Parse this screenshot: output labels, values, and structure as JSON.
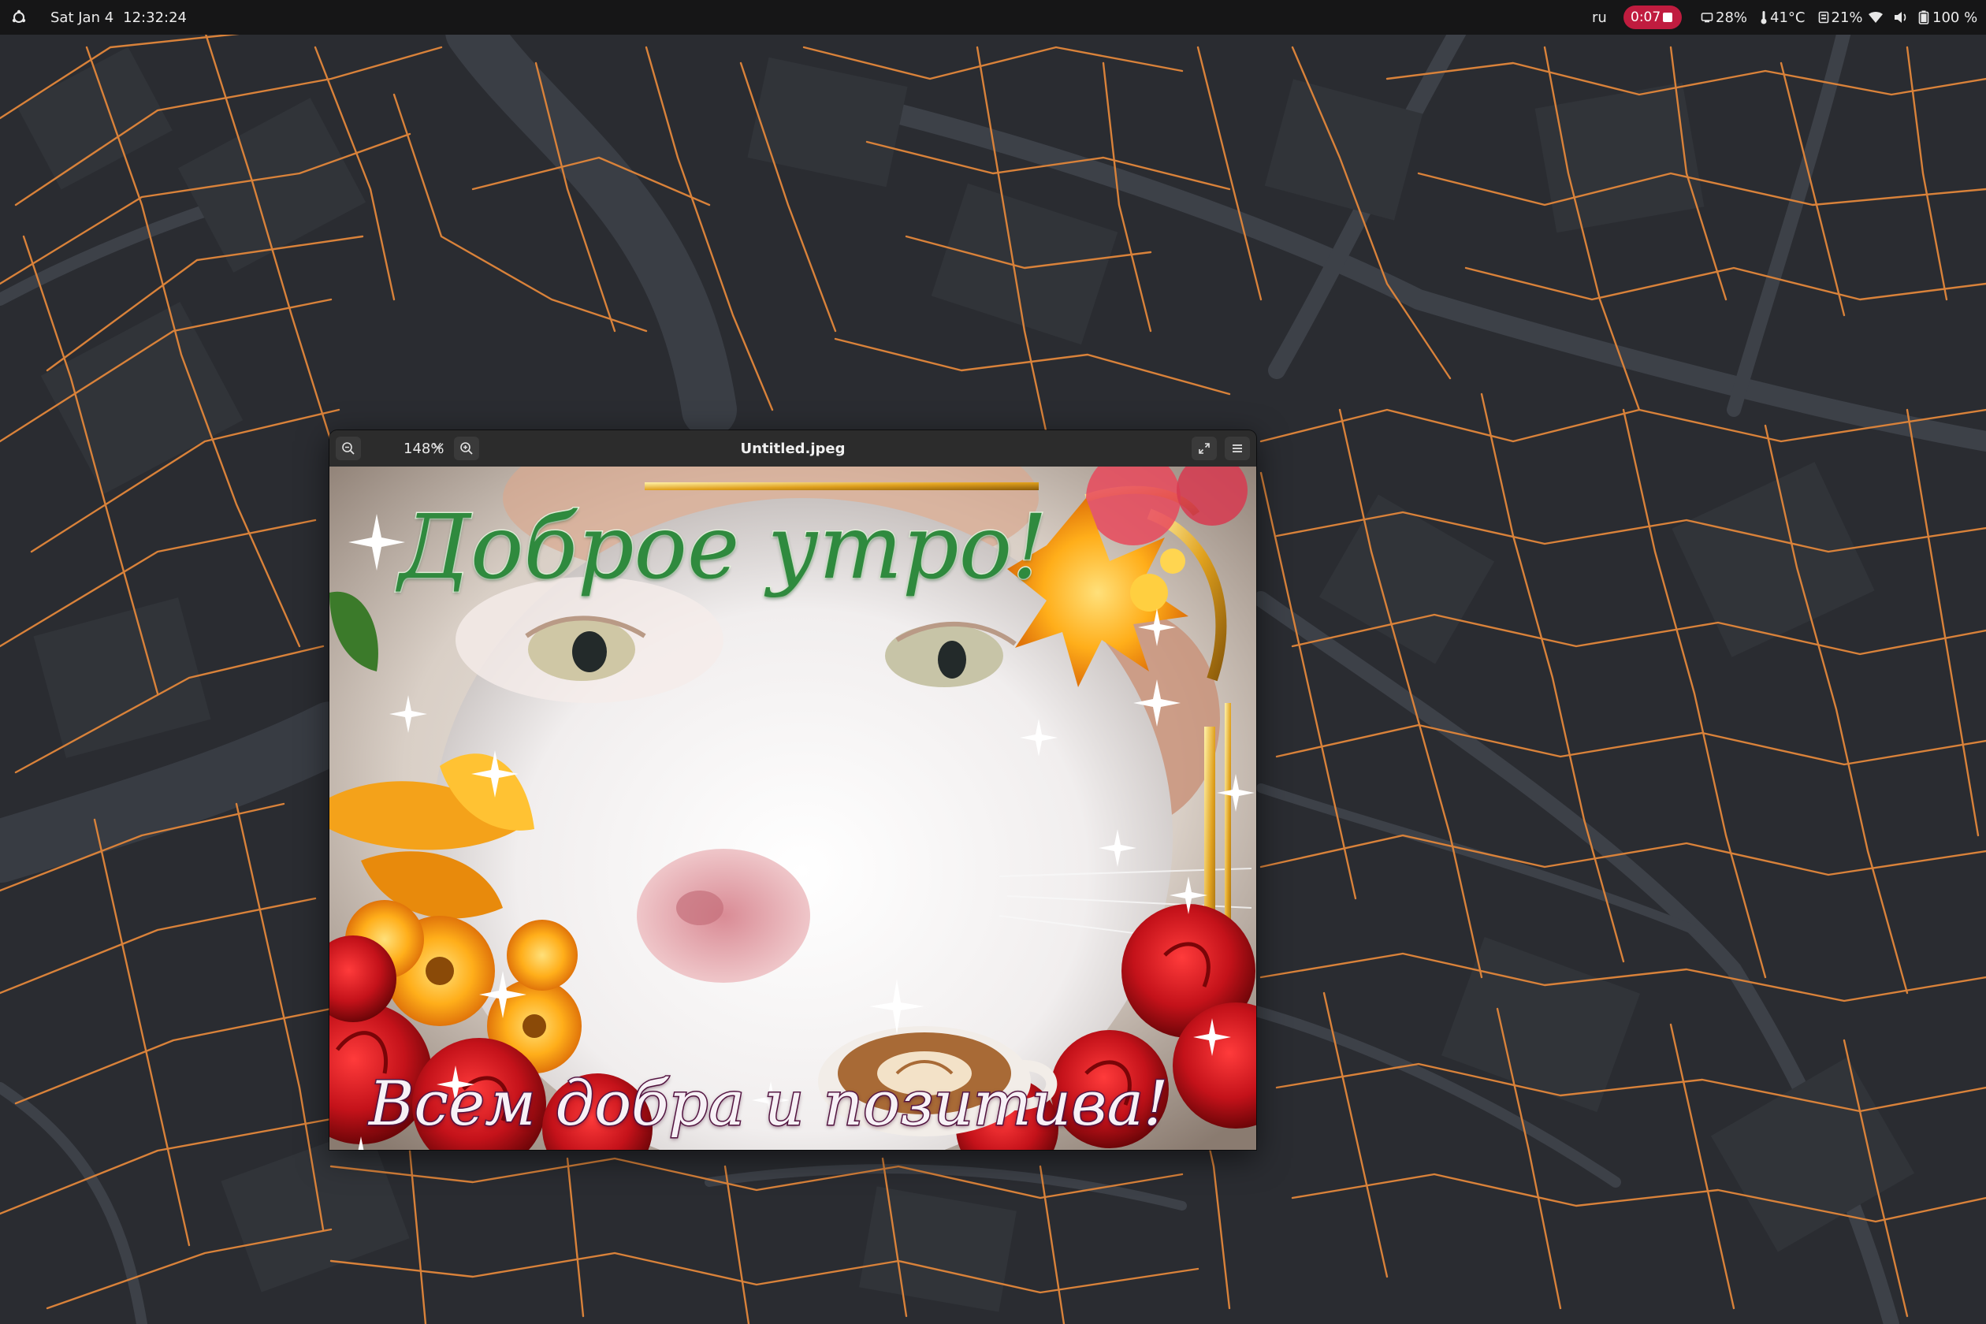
{
  "top_panel": {
    "date": "Sat Jan 4",
    "time": "12:32:24",
    "keyboard_layout": "ru",
    "recording_time": "0:07",
    "cpu": "28%",
    "temperature": "41°C",
    "memory": "21%",
    "battery": "100 %",
    "icons": [
      "activities-icon",
      "stop-recording-icon",
      "cpu-icon",
      "thermometer-icon",
      "memory-icon",
      "wifi-icon",
      "volume-icon",
      "battery-icon"
    ]
  },
  "viewer": {
    "title": "Untitled.jpeg",
    "zoom_level": "148%",
    "icons": [
      "zoom-out-icon",
      "zoom-in-icon",
      "chevron-down-icon",
      "fullscreen-icon",
      "hamburger-menu-icon"
    ]
  },
  "image": {
    "greeting_top": "Доброе утро!",
    "greeting_bottom": "Всем добра и позитива!"
  },
  "colors": {
    "panel_bg": "#161617",
    "recording_pill": "#c01c3f",
    "map_bg": "#2a2c31",
    "map_roads": "#3b3f46",
    "map_lines": "#d9823a",
    "headerbar": "#2c2c2c"
  }
}
